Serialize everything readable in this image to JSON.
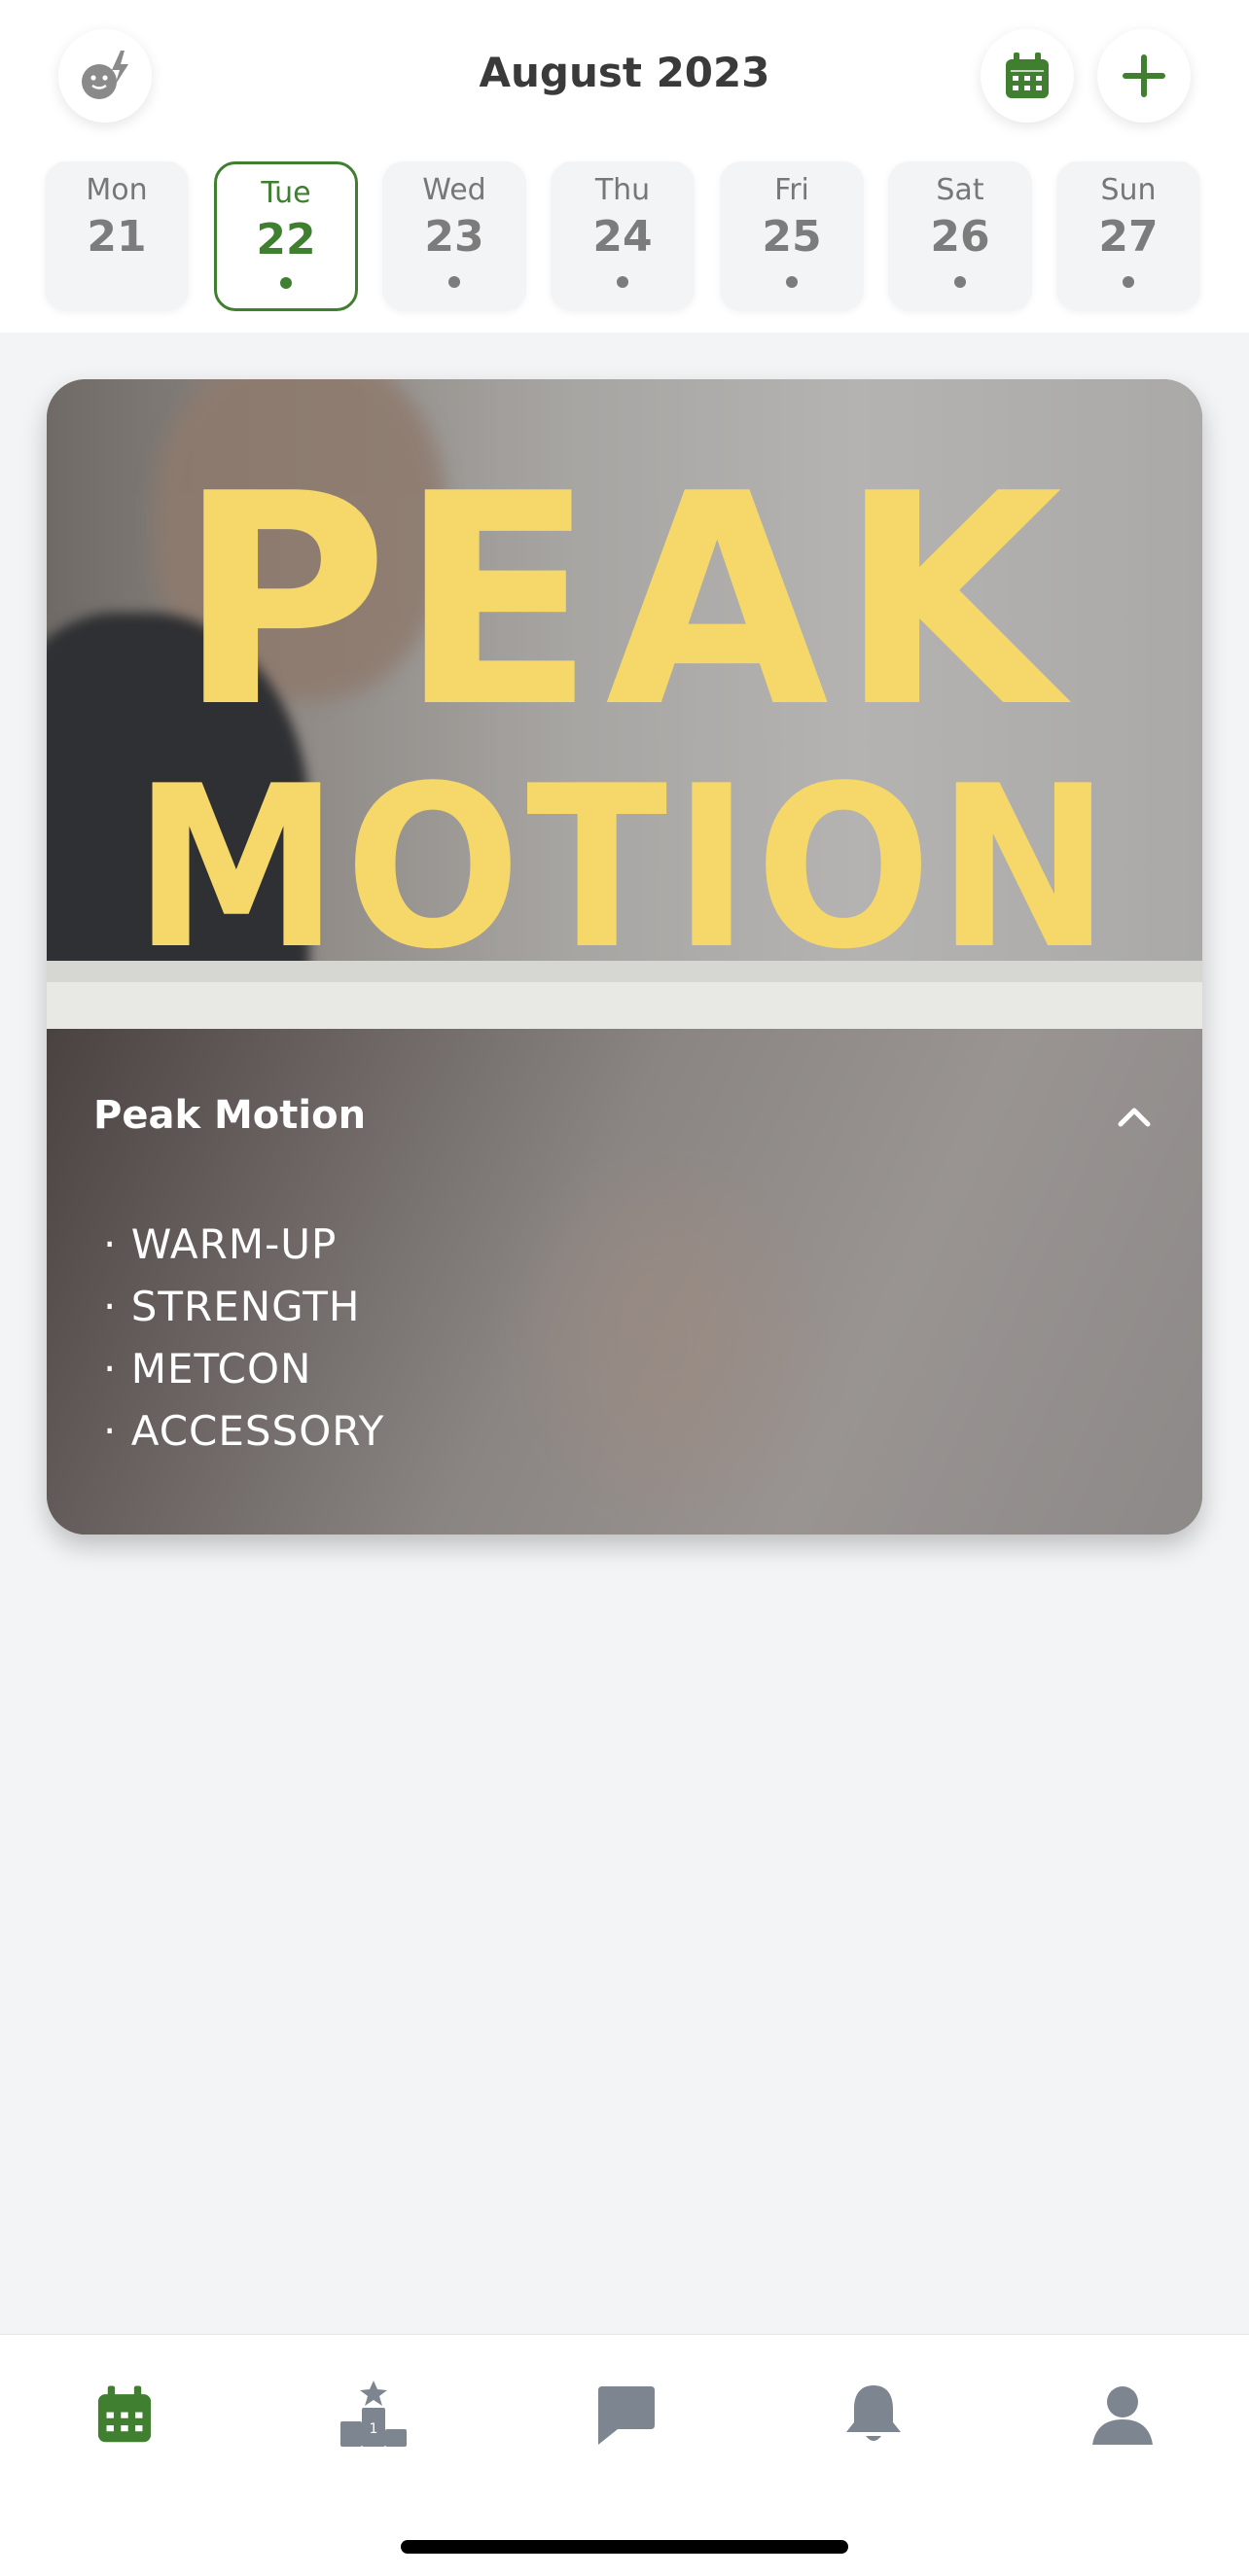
{
  "header": {
    "title": "August 2023",
    "icons": {
      "left": "mood-energy-icon",
      "calendar": "calendar-icon",
      "add": "plus-icon"
    }
  },
  "week": [
    {
      "name": "Mon",
      "num": "21",
      "active": false,
      "dot": false
    },
    {
      "name": "Tue",
      "num": "22",
      "active": true,
      "dot": true
    },
    {
      "name": "Wed",
      "num": "23",
      "active": false,
      "dot": true
    },
    {
      "name": "Thu",
      "num": "24",
      "active": false,
      "dot": true
    },
    {
      "name": "Fri",
      "num": "25",
      "active": false,
      "dot": true
    },
    {
      "name": "Sat",
      "num": "26",
      "active": false,
      "dot": true
    },
    {
      "name": "Sun",
      "num": "27",
      "active": false,
      "dot": true
    }
  ],
  "card": {
    "image_text_line1": "PEAK",
    "image_text_line2": "MOTION",
    "title": "Peak Motion",
    "sections": [
      "· WARM-UP",
      "· STRENGTH",
      "· METCON",
      "· ACCESSORY"
    ]
  },
  "nav": {
    "items": [
      "calendar-icon",
      "leaderboard-icon",
      "chat-icon",
      "bell-icon",
      "profile-icon"
    ]
  },
  "colors": {
    "accent": "#3f7f2f",
    "inactive": "#7d8590",
    "headline_yellow": "#f5d869"
  }
}
